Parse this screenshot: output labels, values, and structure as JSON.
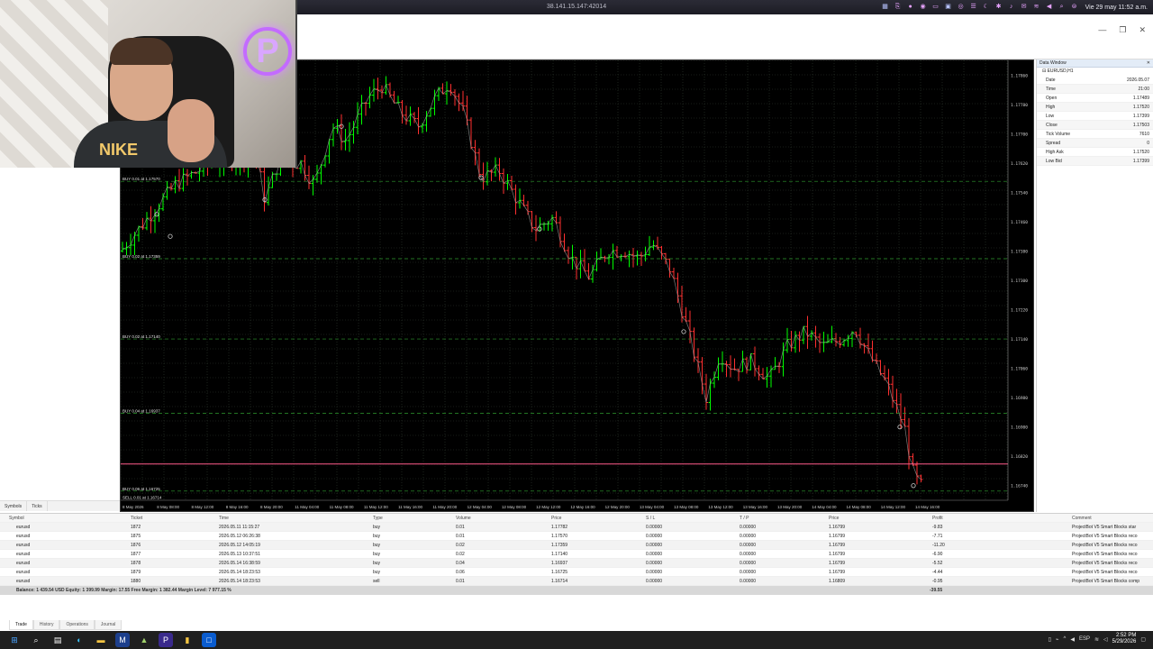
{
  "remote": {
    "title": "38.141.15.147:42014",
    "clock": "Vie 29 may  11:52 a.m."
  },
  "chart": {
    "symbol": "EURUSD,H1",
    "price_labels": [
      "1.17860",
      "1.17780",
      "1.17700",
      "1.17620",
      "1.17540",
      "1.17460",
      "1.17380",
      "1.17300",
      "1.17220",
      "1.17140",
      "1.17060",
      "1.16980",
      "1.16900",
      "1.16820",
      "1.16740"
    ],
    "time_labels": [
      "8 May 2026",
      "8 May 08:00",
      "8 May 12:00",
      "8 May 16:00",
      "8 May 20:00",
      "11 May 04:00",
      "11 May 08:00",
      "11 May 12:00",
      "11 May 16:00",
      "11 May 20:00",
      "12 May 04:00",
      "12 May 08:00",
      "12 May 12:00",
      "12 May 16:00",
      "12 May 20:00",
      "13 May 04:00",
      "13 May 08:00",
      "13 May 12:00",
      "13 May 16:00",
      "13 May 20:00",
      "14 May 04:00",
      "14 May 08:00",
      "14 May 12:00",
      "14 May 16:00"
    ],
    "trade_labels": [
      "BUY 0.01 at 1.17570",
      "BUY 0.02 at 1.17359",
      "BUY 0.02 at 1.17140",
      "BUY 0.04 at 1.16937",
      "BUY 0.06 at 1.16725",
      "SELL 0.01 at 1.16714"
    ],
    "colors": {
      "bg": "#000000",
      "grid": "#2e3a2e",
      "bull": "#00ff00",
      "bear": "#ff3030",
      "bid": "#ff5a8a"
    }
  },
  "data_window": {
    "title": "Data Window",
    "symbol": "EURUSD,H1",
    "rows": [
      {
        "label": "Date",
        "value": "2026.05.07"
      },
      {
        "label": "Time",
        "value": "21:00"
      },
      {
        "label": "Open",
        "value": "1.17489"
      },
      {
        "label": "High",
        "value": "1.17520"
      },
      {
        "label": "Low",
        "value": "1.17399"
      },
      {
        "label": "Close",
        "value": "1.17503"
      },
      {
        "label": "Tick Volume",
        "value": "7610"
      },
      {
        "label": "Spread",
        "value": "0"
      },
      {
        "label": "High Ask",
        "value": "1.17520"
      },
      {
        "label": "Low Bid",
        "value": "1.17399"
      }
    ]
  },
  "sidebar": {
    "tabs": [
      "Symbols",
      "Ticks"
    ]
  },
  "terminal": {
    "headers": [
      "Symbol",
      "Ticket",
      "Time",
      "Type",
      "Volume",
      "Price",
      "S / L",
      "T / P",
      "Price",
      "Profit",
      "Comment"
    ],
    "rows": [
      [
        "eurusd",
        "1872",
        "2026.05.11 11:15:27",
        "buy",
        "0.01",
        "1.17782",
        "0.00000",
        "0.00000",
        "1.16799",
        "-9.83",
        "ProjectBot V5 Smart Blocks star"
      ],
      [
        "eurusd",
        "1875",
        "2026.05.12 06:26:38",
        "buy",
        "0.01",
        "1.17570",
        "0.00000",
        "0.00000",
        "1.16799",
        "-7.71",
        "ProjectBot V5 Smart Blocks reco"
      ],
      [
        "eurusd",
        "1876",
        "2026.05.12 14:05:19",
        "buy",
        "0.02",
        "1.17359",
        "0.00000",
        "0.00000",
        "1.16799",
        "-11.20",
        "ProjectBot V5 Smart Blocks reco"
      ],
      [
        "eurusd",
        "1877",
        "2026.05.13 10:37:51",
        "buy",
        "0.02",
        "1.17140",
        "0.00000",
        "0.00000",
        "1.16799",
        "-6.90",
        "ProjectBot V5 Smart Blocks reco"
      ],
      [
        "eurusd",
        "1878",
        "2026.05.14 16:38:59",
        "buy",
        "0.04",
        "1.16937",
        "0.00000",
        "0.00000",
        "1.16799",
        "-5.52",
        "ProjectBot V5 Smart Blocks reco"
      ],
      [
        "eurusd",
        "1879",
        "2026.05.14 18:23:53",
        "buy",
        "0.06",
        "1.16725",
        "0.00000",
        "0.00000",
        "1.16799",
        "-4.44",
        "ProjectBot V5 Smart Blocks reco"
      ],
      [
        "eurusd",
        "1880",
        "2026.05.14 18:23:53",
        "sell",
        "0.01",
        "1.16714",
        "0.00000",
        "0.00000",
        "1.16809",
        "-0.95",
        "ProjectBot V5 Smart Blocks comp"
      ]
    ],
    "summary": "Balance: 1 439.54 USD  Equity: 1 399.99  Margin: 17.55  Free Margin: 1 382.44  Margin Level: 7 977.15 %",
    "summary_profit": "-39.55",
    "tabs": [
      "Trade",
      "History",
      "Operations",
      "Journal"
    ]
  },
  "taskbar": {
    "time": "2:52 PM",
    "date": "5/29/2026",
    "lang": "ESP"
  },
  "webcam": {
    "overlay_logo": "P",
    "shirt_text": "NIKE"
  }
}
